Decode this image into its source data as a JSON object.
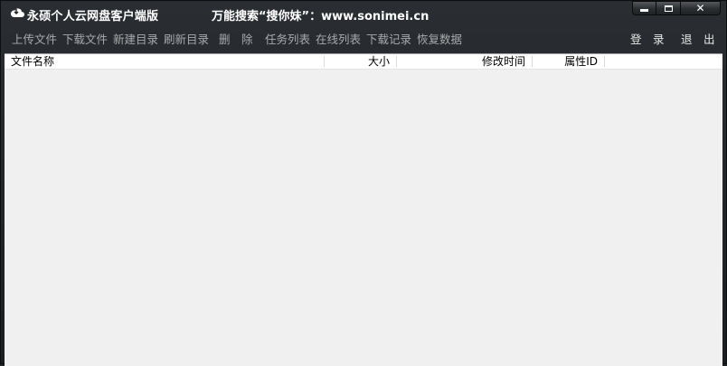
{
  "window": {
    "title": "永硕个人云网盘客户端版",
    "slogan": "万能搜索“搜你妹”：www.sonimei.cn",
    "controls": {
      "close_label": "✕"
    }
  },
  "toolbar": {
    "upload": "上传文件",
    "download": "下载文件",
    "new_dir": "新建目录",
    "refresh_dir": "刷新目录",
    "delete": "删　除",
    "task_list": "任务列表",
    "online_list": "在线列表",
    "download_log": "下载记录",
    "restore_data": "恢复数据",
    "login": "登　录",
    "exit": "退　出"
  },
  "list": {
    "columns": [
      "文件名称",
      "大小",
      "修改时间",
      "属性ID"
    ],
    "rows": []
  },
  "colors": {
    "chrome_bg": "#1e2124",
    "list_bg": "#f0f0f0",
    "toolbar_text": "#a8aaac",
    "title_text": "#ffffff"
  }
}
